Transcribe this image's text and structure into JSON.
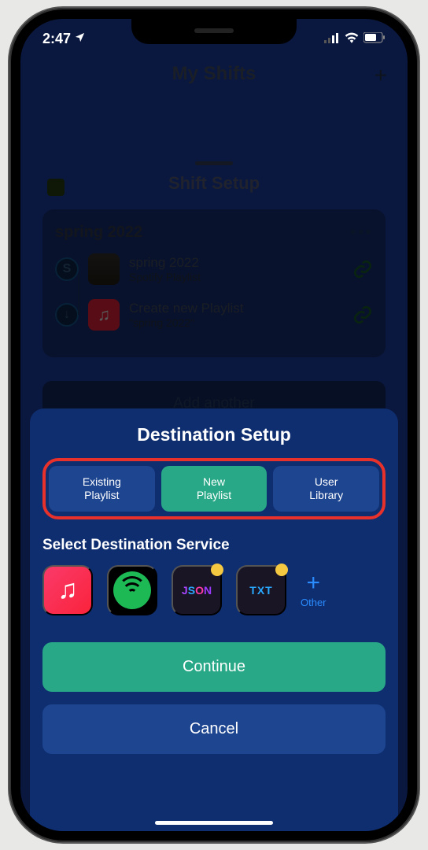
{
  "status": {
    "time": "2:47",
    "loc_icon": "location-arrow"
  },
  "background": {
    "page_title": "My Shifts",
    "sheet_title": "Shift Setup",
    "card": {
      "title": "spring 2022",
      "source": {
        "title": "spring 2022",
        "subtitle": "Spotify Playlist"
      },
      "dest": {
        "title": "Create new Playlist",
        "subtitle": "\"spring 2022\""
      }
    },
    "add_another": "Add another"
  },
  "overlay": {
    "title": "Destination Setup",
    "segments": [
      {
        "line1": "Existing",
        "line2": "Playlist",
        "active": false
      },
      {
        "line1": "New",
        "line2": "Playlist",
        "active": true
      },
      {
        "line1": "User",
        "line2": "Library",
        "active": false
      }
    ],
    "select_label": "Select Destination Service",
    "services": {
      "apple_music": "Apple Music",
      "spotify": "Spotify",
      "json": "JSON",
      "txt": "TXT",
      "other": "Other"
    },
    "continue": "Continue",
    "cancel": "Cancel"
  }
}
